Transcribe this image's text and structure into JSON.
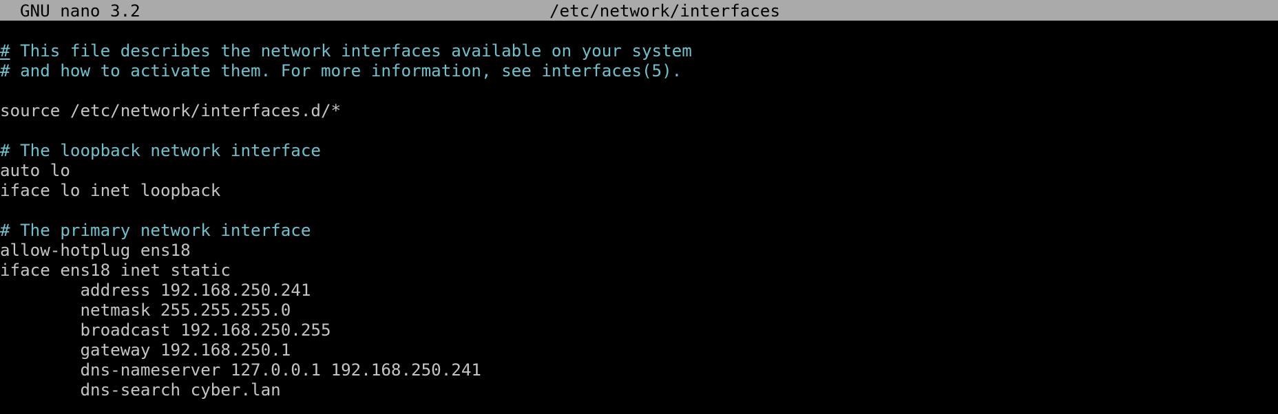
{
  "titlebar": {
    "app_version": "GNU nano 3.2",
    "filename": "/etc/network/interfaces"
  },
  "colors": {
    "background": "#000000",
    "titlebar_bg": "#aaaaaa",
    "comment": "#6fc1cc",
    "text": "#c4c4c4"
  },
  "editor": {
    "lines": [
      {
        "text": " This file describes the network interfaces available on your system",
        "prefix": "#",
        "type": "comment"
      },
      {
        "text": "# and how to activate them. For more information, see interfaces(5).",
        "type": "comment"
      },
      {
        "text": "",
        "type": "blank"
      },
      {
        "text": "source /etc/network/interfaces.d/*",
        "type": "plain"
      },
      {
        "text": "",
        "type": "blank"
      },
      {
        "text": "# The loopback network interface",
        "type": "comment"
      },
      {
        "text": "auto lo",
        "type": "plain"
      },
      {
        "text": "iface lo inet loopback",
        "type": "plain"
      },
      {
        "text": "",
        "type": "blank"
      },
      {
        "text": "# The primary network interface",
        "type": "comment"
      },
      {
        "text": "allow-hotplug ens18",
        "type": "plain"
      },
      {
        "text": "iface ens18 inet static",
        "type": "plain"
      },
      {
        "text": "        address 192.168.250.241",
        "type": "plain"
      },
      {
        "text": "        netmask 255.255.255.0",
        "type": "plain"
      },
      {
        "text": "        broadcast 192.168.250.255",
        "type": "plain"
      },
      {
        "text": "        gateway 192.168.250.1",
        "type": "plain"
      },
      {
        "text": "        dns-nameserver 127.0.0.1 192.168.250.241",
        "type": "plain"
      },
      {
        "text": "        dns-search cyber.lan",
        "type": "plain"
      }
    ]
  }
}
